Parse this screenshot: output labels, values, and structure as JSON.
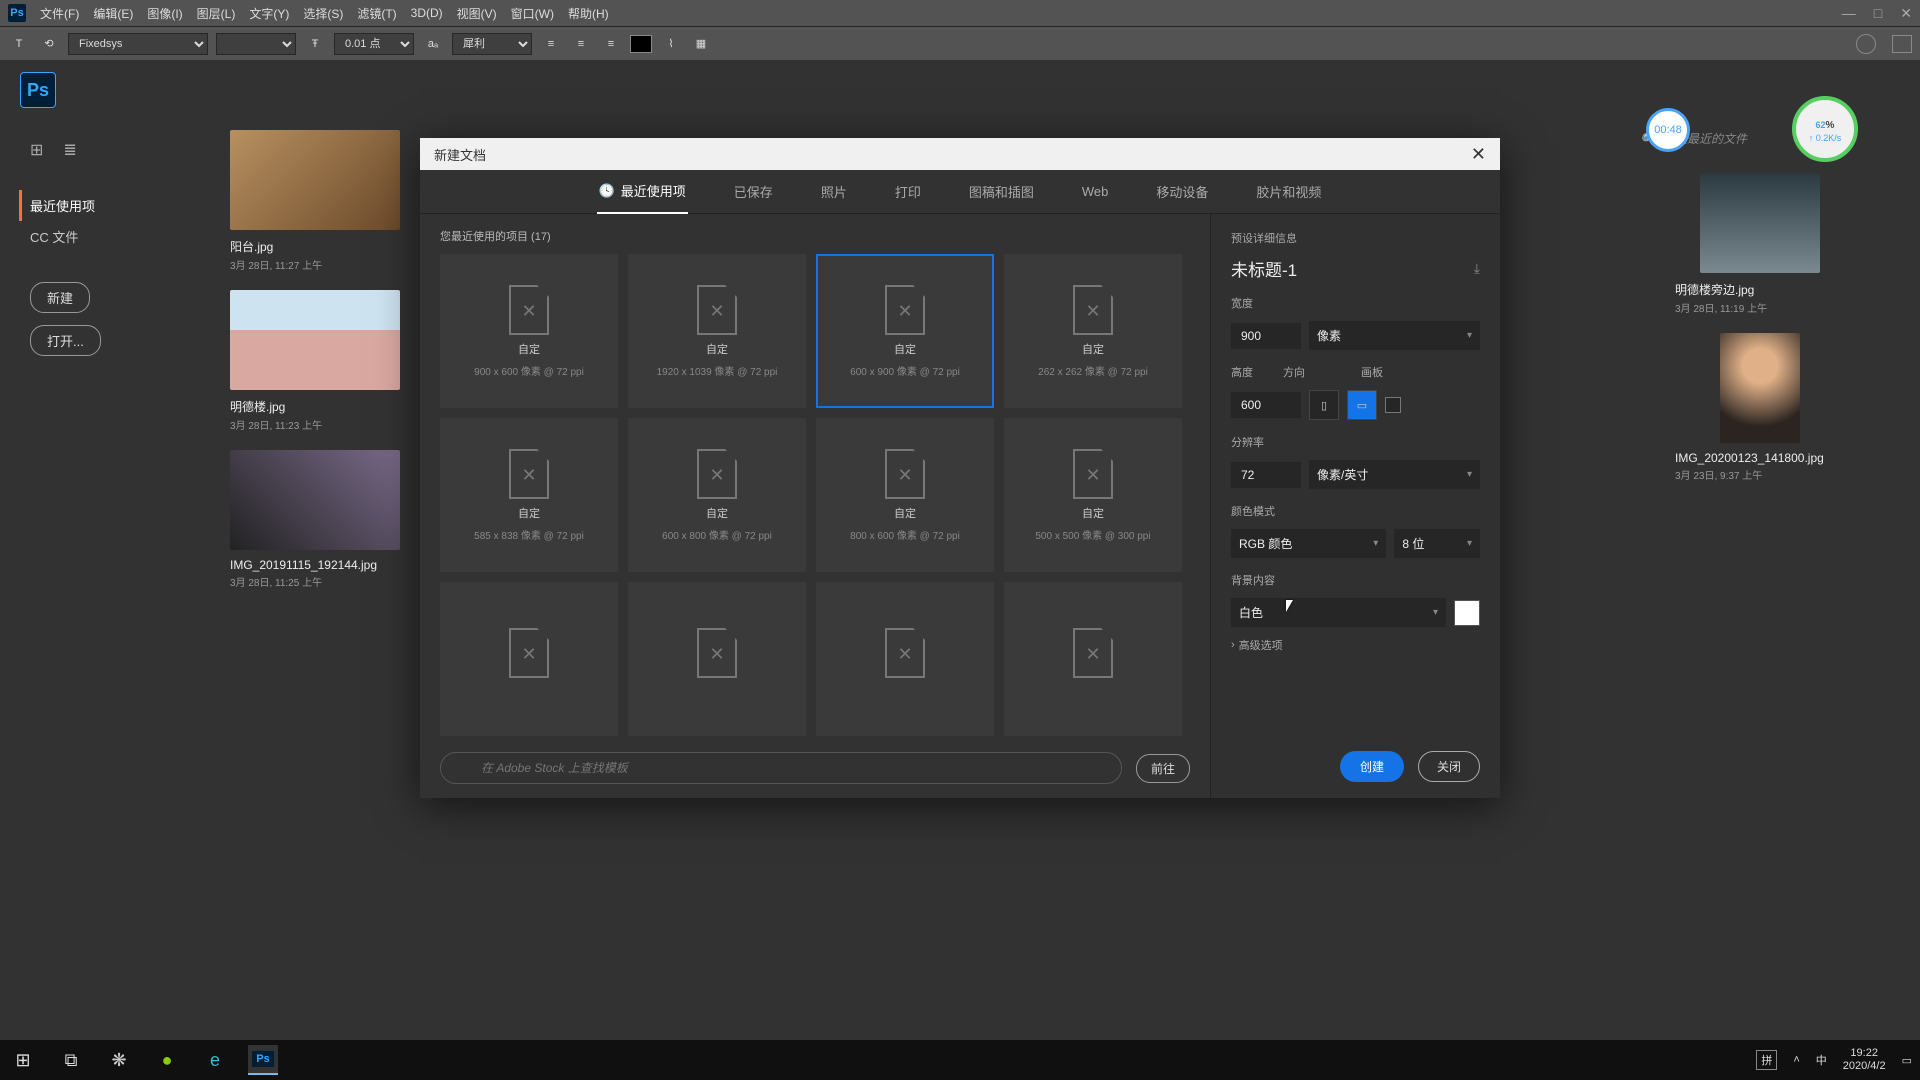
{
  "menubar": {
    "items": [
      "文件(F)",
      "编辑(E)",
      "图像(I)",
      "图层(L)",
      "文字(Y)",
      "选择(S)",
      "滤镜(T)",
      "3D(D)",
      "视图(V)",
      "窗口(W)",
      "帮助(H)"
    ]
  },
  "toolbar": {
    "font": "Fixedsys",
    "size": "0.01 点",
    "aa": "犀利"
  },
  "home": {
    "nav_recent": "最近使用项",
    "nav_cc": "CC 文件",
    "btn_new": "新建",
    "btn_open": "打开...",
    "search_placeholder": "筛选最近的文件",
    "left_thumbs": [
      {
        "name": "阳台.jpg",
        "date": "3月 28日, 11:27 上午"
      },
      {
        "name": "明德楼.jpg",
        "date": "3月 28日, 11:23 上午"
      },
      {
        "name": "IMG_20191115_192144.jpg",
        "date": "3月 28日, 11:25 上午"
      }
    ],
    "right_thumbs": [
      {
        "name": "明德楼旁边.jpg",
        "date": "3月 28日, 11:19 上午"
      },
      {
        "name": "IMG_20200123_141800.jpg",
        "date": "3月 23日, 9:37 上午"
      }
    ]
  },
  "dialog": {
    "title": "新建文档",
    "tabs": [
      "最近使用项",
      "已保存",
      "照片",
      "打印",
      "图稿和插图",
      "Web",
      "移动设备",
      "胶片和视频"
    ],
    "recent_head": "您最近使用的项目 (17)",
    "presets": [
      {
        "name": "自定",
        "dim": "900 x 600 像素 @ 72 ppi"
      },
      {
        "name": "自定",
        "dim": "1920 x 1039 像素 @ 72 ppi"
      },
      {
        "name": "自定",
        "dim": "600 x 900 像素 @ 72 ppi",
        "sel": true
      },
      {
        "name": "自定",
        "dim": "262 x 262 像素 @ 72 ppi"
      },
      {
        "name": "自定",
        "dim": "585 x 838 像素 @ 72 ppi"
      },
      {
        "name": "自定",
        "dim": "600 x 800 像素 @ 72 ppi"
      },
      {
        "name": "自定",
        "dim": "800 x 600 像素 @ 72 ppi"
      },
      {
        "name": "自定",
        "dim": "500 x 500 像素 @ 300 ppi"
      },
      {
        "name": "",
        "dim": ""
      },
      {
        "name": "",
        "dim": ""
      },
      {
        "name": "",
        "dim": ""
      },
      {
        "name": "",
        "dim": ""
      }
    ],
    "stock_placeholder": "在 Adobe Stock 上查找模板",
    "stock_go": "前往",
    "details": {
      "head": "预设详细信息",
      "docname": "未标题-1",
      "w_label": "宽度",
      "w": "900",
      "unit": "像素",
      "h_label": "高度",
      "h": "600",
      "orient_label": "方向",
      "artboard_label": "画板",
      "res_label": "分辨率",
      "res": "72",
      "res_unit": "像素/英寸",
      "mode_label": "颜色模式",
      "mode": "RGB 颜色",
      "depth": "8 位",
      "bg_label": "背景内容",
      "bg": "白色",
      "advanced": "高级选项",
      "create": "创建",
      "close": "关闭"
    }
  },
  "overlay": {
    "timer": "00:48",
    "net_pct": "62",
    "net_unit": "%",
    "net_speed": "0.2K/s"
  },
  "taskbar": {
    "ime1": "拼",
    "ime2": "中",
    "time": "19:22",
    "date": "2020/4/2"
  }
}
